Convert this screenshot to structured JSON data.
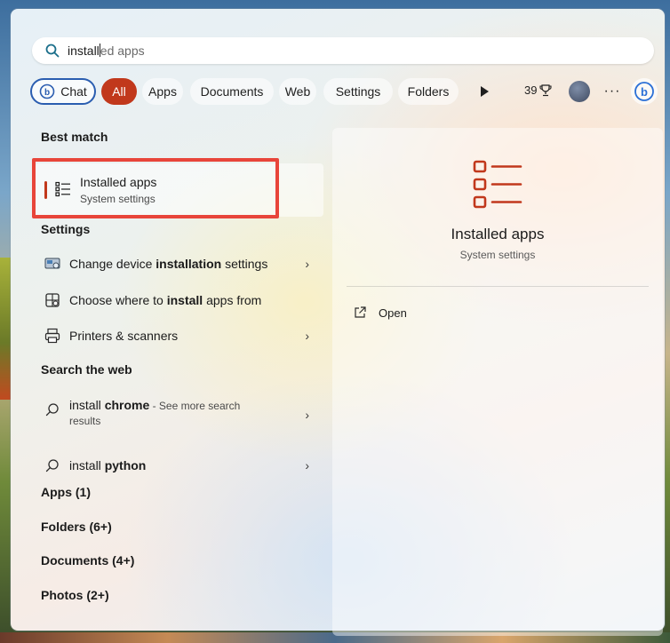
{
  "search": {
    "typed": "install",
    "suggestion": "ed apps"
  },
  "filters": {
    "chat_label": "Chat",
    "all_label": "All",
    "apps_label": "Apps",
    "documents_label": "Documents",
    "web_label": "Web",
    "settings_label": "Settings",
    "folders_label": "Folders",
    "points": "39"
  },
  "left": {
    "best_match_heading": "Best match",
    "best_match": {
      "title_bold": "Install",
      "title_rest": "ed apps",
      "subtitle": "System settings"
    },
    "settings_heading": "Settings",
    "settings_items": [
      {
        "pre": "Change device ",
        "bold": "installation",
        "post": " settings"
      },
      {
        "pre": "Choose where to ",
        "bold": "install",
        "post": " apps from"
      },
      {
        "pre": "Printers & scanners",
        "bold": "",
        "post": ""
      }
    ],
    "web_heading": "Search the web",
    "web_items": [
      {
        "pre": "install ",
        "bold": "chrome",
        "see_more": " - See more search",
        "line2": "results"
      },
      {
        "pre": "install ",
        "bold": "python",
        "see_more": "",
        "line2": ""
      }
    ],
    "categories": [
      "Apps (1)",
      "Folders (6+)",
      "Documents (4+)",
      "Photos (2+)"
    ]
  },
  "preview": {
    "title": "Installed apps",
    "subtitle": "System settings",
    "open_label": "Open"
  },
  "colors": {
    "accent": "#c1381c",
    "highlight": "#e8453a",
    "chat_border": "#2a5db0"
  }
}
